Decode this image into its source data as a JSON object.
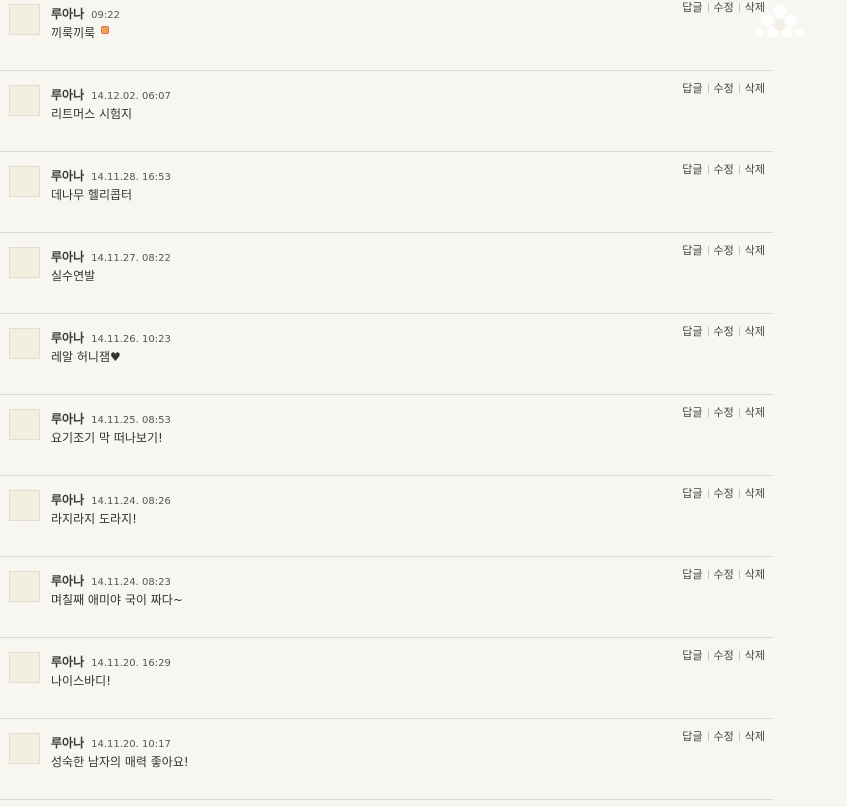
{
  "actions": {
    "reply": "답글",
    "edit": "수정",
    "delete": "삭제"
  },
  "comments": [
    {
      "author": "루아나",
      "date": "09:22",
      "text": "끼룩끼룩",
      "is_new": true
    },
    {
      "author": "루아나",
      "date": "14.12.02. 06:07",
      "text": "리트머스 시험지"
    },
    {
      "author": "루아나",
      "date": "14.11.28. 16:53",
      "text": "데나무 헬리콥터"
    },
    {
      "author": "루아나",
      "date": "14.11.27. 08:22",
      "text": "실수연발"
    },
    {
      "author": "루아나",
      "date": "14.11.26. 10:23",
      "text": "레알 허니잼♥"
    },
    {
      "author": "루아나",
      "date": "14.11.25. 08:53",
      "text": "요기조기 막 떠나보기!"
    },
    {
      "author": "루아나",
      "date": "14.11.24. 08:26",
      "text": "라지라지 도라지!"
    },
    {
      "author": "루아나",
      "date": "14.11.24. 08:23",
      "text": "며칠째 애미야 국이 짜다~"
    },
    {
      "author": "루아나",
      "date": "14.11.20. 16:29",
      "text": "나이스바디!"
    },
    {
      "author": "루아나",
      "date": "14.11.20. 10:17",
      "text": "성숙한 남자의 매력 좋아요!"
    }
  ],
  "icons": {
    "new_badge": "new-badge-icon",
    "decoration": "snowflake-icon"
  },
  "colors": {
    "background": "#f8f6f1",
    "divider": "#dcd8cf",
    "avatar": "#f3efe0",
    "new_badge": "#f0a25a"
  }
}
